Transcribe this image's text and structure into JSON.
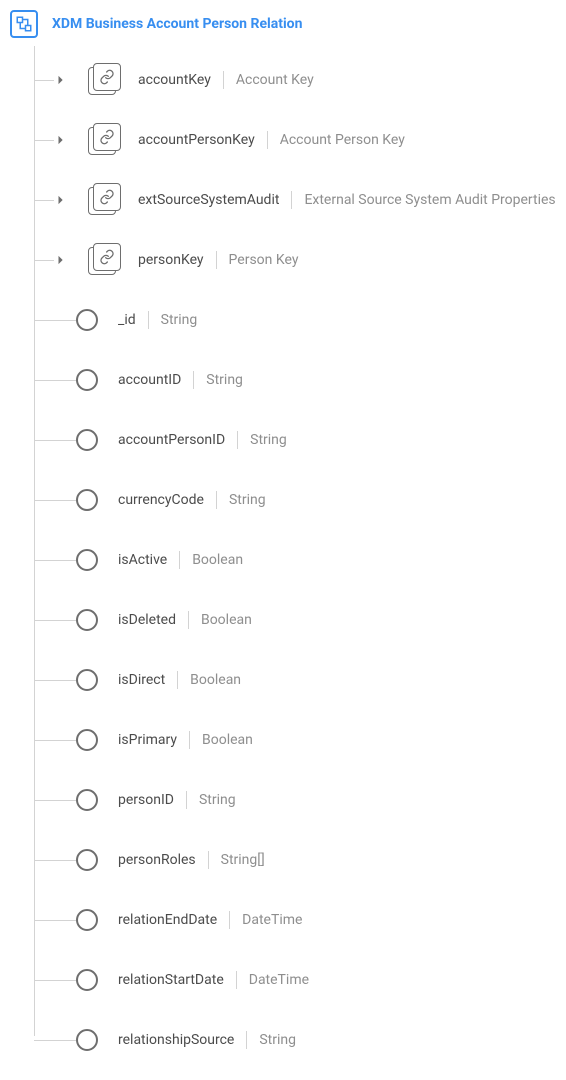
{
  "root": {
    "title": "XDM Business Account Person Relation"
  },
  "nodes": [
    {
      "kind": "object",
      "name": "accountKey",
      "type": "Account Key"
    },
    {
      "kind": "object",
      "name": "accountPersonKey",
      "type": "Account Person Key"
    },
    {
      "kind": "object",
      "name": "extSourceSystemAudit",
      "type": "External Source System Audit Properties"
    },
    {
      "kind": "object",
      "name": "personKey",
      "type": "Person Key"
    },
    {
      "kind": "leaf",
      "name": "_id",
      "type": "String"
    },
    {
      "kind": "leaf",
      "name": "accountID",
      "type": "String"
    },
    {
      "kind": "leaf",
      "name": "accountPersonID",
      "type": "String"
    },
    {
      "kind": "leaf",
      "name": "currencyCode",
      "type": "String"
    },
    {
      "kind": "leaf",
      "name": "isActive",
      "type": "Boolean"
    },
    {
      "kind": "leaf",
      "name": "isDeleted",
      "type": "Boolean"
    },
    {
      "kind": "leaf",
      "name": "isDirect",
      "type": "Boolean"
    },
    {
      "kind": "leaf",
      "name": "isPrimary",
      "type": "Boolean"
    },
    {
      "kind": "leaf",
      "name": "personID",
      "type": "String"
    },
    {
      "kind": "leaf",
      "name": "personRoles",
      "type": "String[]"
    },
    {
      "kind": "leaf",
      "name": "relationEndDate",
      "type": "DateTime"
    },
    {
      "kind": "leaf",
      "name": "relationStartDate",
      "type": "DateTime"
    },
    {
      "kind": "leaf",
      "name": "relationshipSource",
      "type": "String"
    }
  ]
}
